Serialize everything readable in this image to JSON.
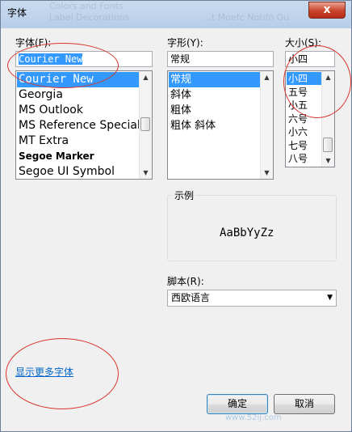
{
  "window": {
    "title": "字体",
    "close_icon": "close-icon",
    "close_glyph": "x"
  },
  "background_ghost": {
    "left": "Colors and Fonts",
    "right": "…t Moefc Notifo Ou",
    "left2": "Label Decorations"
  },
  "font": {
    "label": "字体(F):",
    "value": "Courier New",
    "items": [
      {
        "label": "Courier New",
        "selected": true
      },
      {
        "label": "Georgia",
        "selected": false
      },
      {
        "label": "MS Outlook",
        "selected": false
      },
      {
        "label": "MS Reference Specialt",
        "selected": false
      },
      {
        "label": "MT Extra",
        "selected": false
      },
      {
        "label": "Segoe Marker",
        "selected": false
      },
      {
        "label": "Segoe UI Symbol",
        "selected": false
      }
    ]
  },
  "style": {
    "label": "字形(Y):",
    "value": "常规",
    "items": [
      {
        "label": "常规",
        "selected": true
      },
      {
        "label": "斜体",
        "selected": false
      },
      {
        "label": "粗体",
        "selected": false
      },
      {
        "label": "粗体 斜体",
        "selected": false
      }
    ]
  },
  "size": {
    "label": "大小(S):",
    "value": "小四",
    "items": [
      {
        "label": "小四",
        "selected": true
      },
      {
        "label": "五号",
        "selected": false
      },
      {
        "label": "小五",
        "selected": false
      },
      {
        "label": "六号",
        "selected": false
      },
      {
        "label": "小六",
        "selected": false
      },
      {
        "label": "七号",
        "selected": false
      },
      {
        "label": "八号",
        "selected": false
      }
    ]
  },
  "sample": {
    "label": "示例",
    "text": "AaBbYyZz"
  },
  "script": {
    "label": "脚本(R):",
    "value": "西欧语言"
  },
  "more_fonts_link": "显示更多字体",
  "buttons": {
    "ok": "确定",
    "cancel": "取消"
  },
  "scroll": {
    "up_glyph": "▲",
    "down_glyph": "▼"
  },
  "watermark": {
    "text": "www.52ij.com"
  },
  "annotation_color": "#d9342b",
  "selection_color": "#3399ff"
}
